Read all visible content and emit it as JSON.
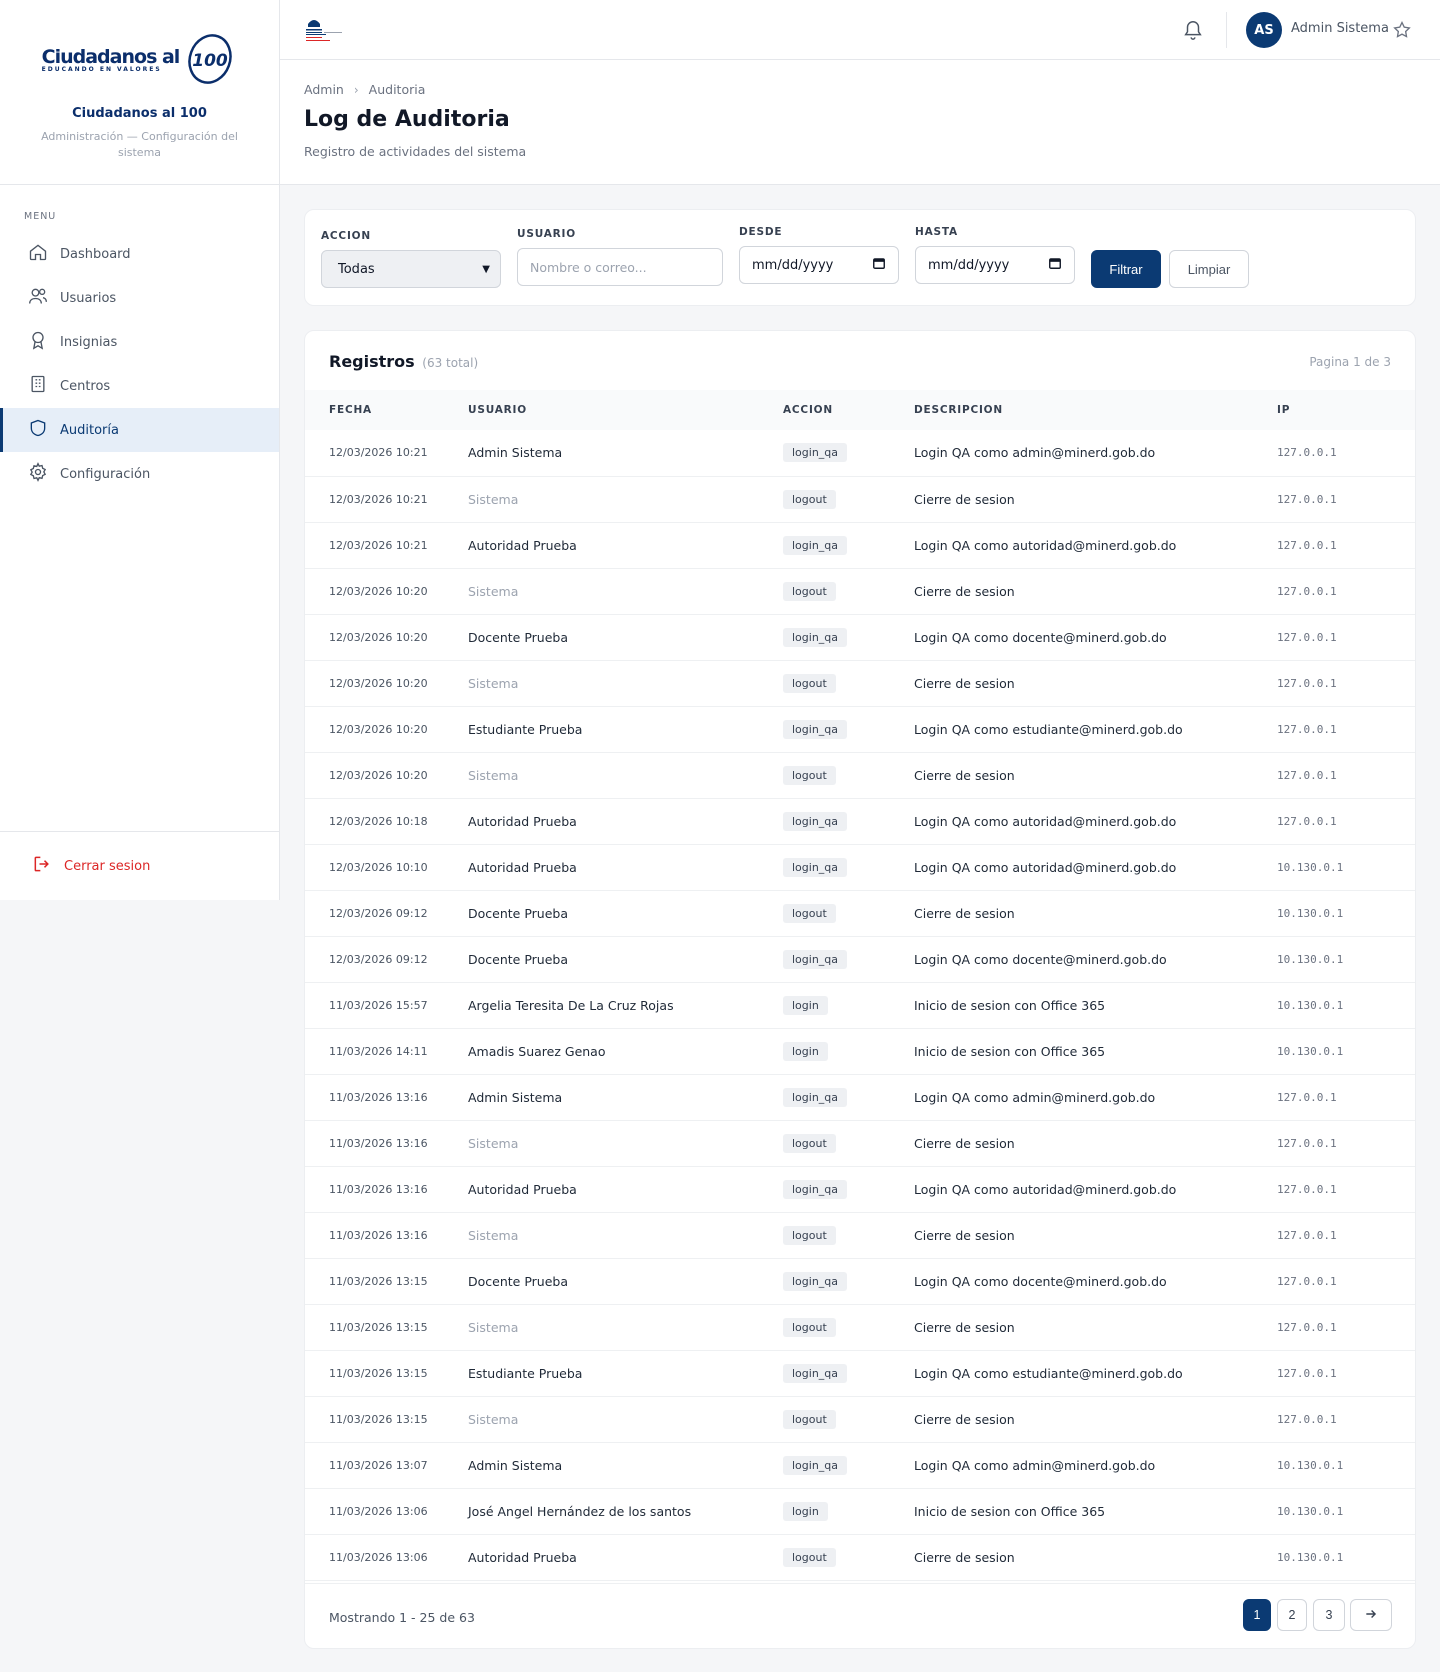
{
  "brand": {
    "logo_main": "Ciudadanos al",
    "logo_badge": "100",
    "logo_sub": "EDUCANDO EN VALORES",
    "name": "Ciudadanos al 100",
    "description": "Administración — Configuración del sistema"
  },
  "sidebar": {
    "menu_label": "MENU",
    "items": [
      {
        "label": "Dashboard",
        "icon": "home-icon"
      },
      {
        "label": "Usuarios",
        "icon": "users-icon"
      },
      {
        "label": "Insignias",
        "icon": "award-icon"
      },
      {
        "label": "Centros",
        "icon": "building-icon"
      },
      {
        "label": "Auditoría",
        "icon": "shield-icon",
        "active": true
      },
      {
        "label": "Configuración",
        "icon": "gear-icon"
      }
    ],
    "logout_label": "Cerrar sesion"
  },
  "header": {
    "avatar_initials": "AS",
    "user_name": "Admin Sistema"
  },
  "page": {
    "breadcrumb": [
      "Admin",
      "Auditoria"
    ],
    "title": "Log de Auditoria",
    "subtitle": "Registro de actividades del sistema"
  },
  "filters": {
    "accion_label": "ACCION",
    "accion_value": "Todas",
    "usuario_label": "USUARIO",
    "usuario_placeholder": "Nombre o correo...",
    "desde_label": "DESDE",
    "desde_value": "mm/dd/yyyy",
    "hasta_label": "HASTA",
    "hasta_value": "mm/dd/yyyy",
    "filtrar_label": "Filtrar",
    "limpiar_label": "Limpiar"
  },
  "records": {
    "title": "Registros",
    "count": "(63 total)",
    "page_info": "Pagina 1 de 3",
    "columns": [
      "FECHA",
      "USUARIO",
      "ACCION",
      "DESCRIPCION",
      "IP"
    ],
    "rows": [
      [
        "12/03/2026 10:21",
        "Admin Sistema",
        "login_qa",
        "Login QA como admin@minerd.gob.do",
        "127.0.0.1"
      ],
      [
        "12/03/2026 10:21",
        "Sistema",
        "logout",
        "Cierre de sesion",
        "127.0.0.1"
      ],
      [
        "12/03/2026 10:21",
        "Autoridad Prueba",
        "login_qa",
        "Login QA como autoridad@minerd.gob.do",
        "127.0.0.1"
      ],
      [
        "12/03/2026 10:20",
        "Sistema",
        "logout",
        "Cierre de sesion",
        "127.0.0.1"
      ],
      [
        "12/03/2026 10:20",
        "Docente Prueba",
        "login_qa",
        "Login QA como docente@minerd.gob.do",
        "127.0.0.1"
      ],
      [
        "12/03/2026 10:20",
        "Sistema",
        "logout",
        "Cierre de sesion",
        "127.0.0.1"
      ],
      [
        "12/03/2026 10:20",
        "Estudiante Prueba",
        "login_qa",
        "Login QA como estudiante@minerd.gob.do",
        "127.0.0.1"
      ],
      [
        "12/03/2026 10:20",
        "Sistema",
        "logout",
        "Cierre de sesion",
        "127.0.0.1"
      ],
      [
        "12/03/2026 10:18",
        "Autoridad Prueba",
        "login_qa",
        "Login QA como autoridad@minerd.gob.do",
        "127.0.0.1"
      ],
      [
        "12/03/2026 10:10",
        "Autoridad Prueba",
        "login_qa",
        "Login QA como autoridad@minerd.gob.do",
        "10.130.0.1"
      ],
      [
        "12/03/2026 09:12",
        "Docente Prueba",
        "logout",
        "Cierre de sesion",
        "10.130.0.1"
      ],
      [
        "12/03/2026 09:12",
        "Docente Prueba",
        "login_qa",
        "Login QA como docente@minerd.gob.do",
        "10.130.0.1"
      ],
      [
        "11/03/2026 15:57",
        "Argelia Teresita De La Cruz Rojas",
        "login",
        "Inicio de sesion con Office 365",
        "10.130.0.1"
      ],
      [
        "11/03/2026 14:11",
        "Amadis Suarez Genao",
        "login",
        "Inicio de sesion con Office 365",
        "10.130.0.1"
      ],
      [
        "11/03/2026 13:16",
        "Admin Sistema",
        "login_qa",
        "Login QA como admin@minerd.gob.do",
        "127.0.0.1"
      ],
      [
        "11/03/2026 13:16",
        "Sistema",
        "logout",
        "Cierre de sesion",
        "127.0.0.1"
      ],
      [
        "11/03/2026 13:16",
        "Autoridad Prueba",
        "login_qa",
        "Login QA como autoridad@minerd.gob.do",
        "127.0.0.1"
      ],
      [
        "11/03/2026 13:16",
        "Sistema",
        "logout",
        "Cierre de sesion",
        "127.0.0.1"
      ],
      [
        "11/03/2026 13:15",
        "Docente Prueba",
        "login_qa",
        "Login QA como docente@minerd.gob.do",
        "127.0.0.1"
      ],
      [
        "11/03/2026 13:15",
        "Sistema",
        "logout",
        "Cierre de sesion",
        "127.0.0.1"
      ],
      [
        "11/03/2026 13:15",
        "Estudiante Prueba",
        "login_qa",
        "Login QA como estudiante@minerd.gob.do",
        "127.0.0.1"
      ],
      [
        "11/03/2026 13:15",
        "Sistema",
        "logout",
        "Cierre de sesion",
        "127.0.0.1"
      ],
      [
        "11/03/2026 13:07",
        "Admin Sistema",
        "login_qa",
        "Login QA como admin@minerd.gob.do",
        "10.130.0.1"
      ],
      [
        "11/03/2026 13:06",
        "José Angel Hernández de los santos",
        "login",
        "Inicio de sesion con Office 365",
        "10.130.0.1"
      ],
      [
        "11/03/2026 13:06",
        "Autoridad Prueba",
        "logout",
        "Cierre de sesion",
        "10.130.0.1"
      ]
    ],
    "showing": "Mostrando 1 - 25 de 63",
    "pages": [
      "1",
      "2",
      "3"
    ],
    "current_page": "1"
  },
  "colors": {
    "primary": "#0b3a73",
    "danger": "#dc2626",
    "active_bg": "#e6eef8"
  }
}
